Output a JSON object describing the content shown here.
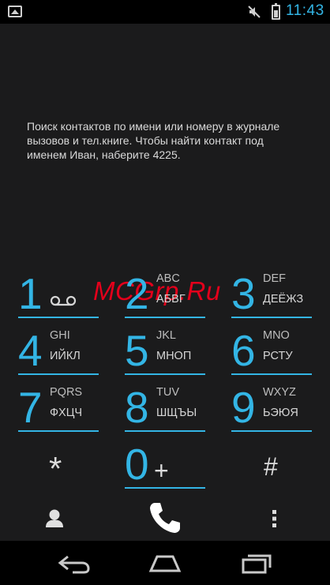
{
  "status_bar": {
    "time": "11:43",
    "left_icon": "image-notification-icon",
    "mute_icon": "mute-icon",
    "battery_icon": "battery-icon",
    "accent_color": "#33b5e5"
  },
  "hint_text": "Поиск контактов по имени или номеру в журнале вызовов и тел.книге. Чтобы найти контакт под именем Иван, наберите 4225.",
  "watermark": "MCGrp.Ru",
  "keypad": {
    "keys": [
      {
        "digit": "1",
        "latin": "",
        "cyrillic": ""
      },
      {
        "digit": "2",
        "latin": "ABC",
        "cyrillic": "АБВГ"
      },
      {
        "digit": "3",
        "latin": "DEF",
        "cyrillic": "ДЕЁЖЗ"
      },
      {
        "digit": "4",
        "latin": "GHI",
        "cyrillic": "ИЙКЛ"
      },
      {
        "digit": "5",
        "latin": "JKL",
        "cyrillic": "МНОП"
      },
      {
        "digit": "6",
        "latin": "MNO",
        "cyrillic": "РСТУ"
      },
      {
        "digit": "7",
        "latin": "PQRS",
        "cyrillic": "ФХЦЧ"
      },
      {
        "digit": "8",
        "latin": "TUV",
        "cyrillic": "ШЩЪЫ"
      },
      {
        "digit": "9",
        "latin": "WXYZ",
        "cyrillic": "ЬЭЮЯ"
      },
      {
        "digit": "0",
        "latin": "",
        "cyrillic": ""
      }
    ],
    "star": "*",
    "hash": "#",
    "plus": "+",
    "voicemail_icon": "voicemail-icon"
  },
  "actions": {
    "contacts_icon": "contacts-icon",
    "call_icon": "phone-call-icon",
    "more_icon": "overflow-menu-icon"
  },
  "nav_bar": {
    "back_icon": "back-icon",
    "home_icon": "home-icon",
    "recents_icon": "recent-apps-icon"
  }
}
